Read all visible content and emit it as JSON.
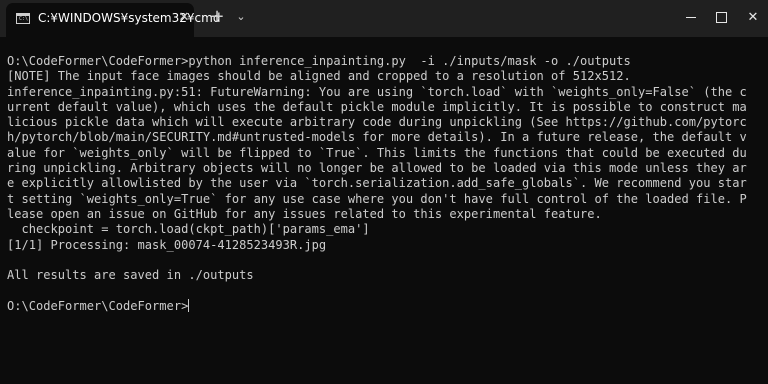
{
  "titlebar": {
    "tab_icon_text": "C:\\",
    "tab_title": "C:¥WINDOWS¥system32¥cmd",
    "tab_close": "✕",
    "new_tab": "+",
    "tab_menu": "⌄",
    "close": "✕"
  },
  "terminal": {
    "lines": [
      "O:\\CodeFormer\\CodeFormer>python inference_inpainting.py  -i ./inputs/mask -o ./outputs",
      "[NOTE] The input face images should be aligned and cropped to a resolution of 512x512.",
      "inference_inpainting.py:51: FutureWarning: You are using `torch.load` with `weights_only=False` (the c",
      "urrent default value), which uses the default pickle module implicitly. It is possible to construct ma",
      "licious pickle data which will execute arbitrary code during unpickling (See https://github.com/pytorc",
      "h/pytorch/blob/main/SECURITY.md#untrusted-models for more details). In a future release, the default v",
      "alue for `weights_only` will be flipped to `True`. This limits the functions that could be executed du",
      "ring unpickling. Arbitrary objects will no longer be allowed to be loaded via this mode unless they ar",
      "e explicitly allowlisted by the user via `torch.serialization.add_safe_globals`. We recommend you star",
      "t setting `weights_only=True` for any use case where you don't have full control of the loaded file. P",
      "lease open an issue on GitHub for any issues related to this experimental feature.",
      "  checkpoint = torch.load(ckpt_path)['params_ema']",
      "[1/1] Processing: mask_00074-4128523493R.jpg",
      "",
      "All results are saved in ./outputs",
      ""
    ],
    "prompt": "O:\\CodeFormer\\CodeFormer>"
  }
}
